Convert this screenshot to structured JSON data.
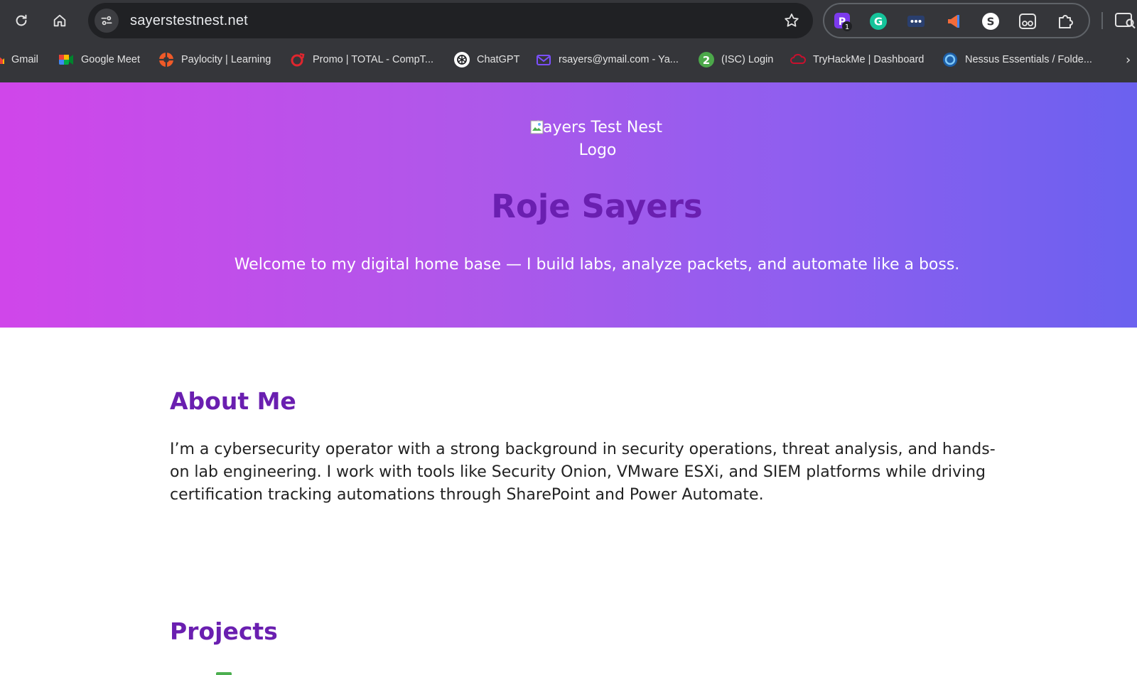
{
  "browser": {
    "url": "sayerstestnest.net",
    "extension_badge": "1",
    "bookmarks": [
      {
        "label": "Gmail",
        "icon": "gmail-icon"
      },
      {
        "label": "Google Meet",
        "icon": "google-meet-icon"
      },
      {
        "label": "Paylocity | Learning",
        "icon": "paylocity-icon"
      },
      {
        "label": "Promo | TOTAL - CompT...",
        "icon": "promo-icon"
      },
      {
        "label": "ChatGPT",
        "icon": "chatgpt-icon"
      },
      {
        "label": "rsayers@ymail.com - Ya...",
        "icon": "mail-icon"
      },
      {
        "label": "(ISC) Login",
        "icon": "isc2-icon"
      },
      {
        "label": "TryHackMe | Dashboard",
        "icon": "tryhackme-icon"
      },
      {
        "label": "Nessus Essentials / Folde...",
        "icon": "nessus-icon"
      }
    ]
  },
  "hero": {
    "logo_alt": "Sayers Test Nest Logo",
    "name": "Roje Sayers",
    "tagline": "Welcome to my digital home base — I build labs, analyze packets, and automate like a boss."
  },
  "about": {
    "title": "About Me",
    "text": "I’m a cybersecurity operator with a strong background in security operations, threat analysis, and hands-on lab engineering. I work with tools like Security Onion, VMware ESXi, and SIEM platforms while driving certification tracking automations through SharePoint and Power Automate."
  },
  "projects": {
    "title": "Projects"
  },
  "colors": {
    "accent": "#6a1fb0",
    "gradient_start": "#d046ea",
    "gradient_end": "#6b61ef",
    "chrome_bg": "#35363a"
  }
}
